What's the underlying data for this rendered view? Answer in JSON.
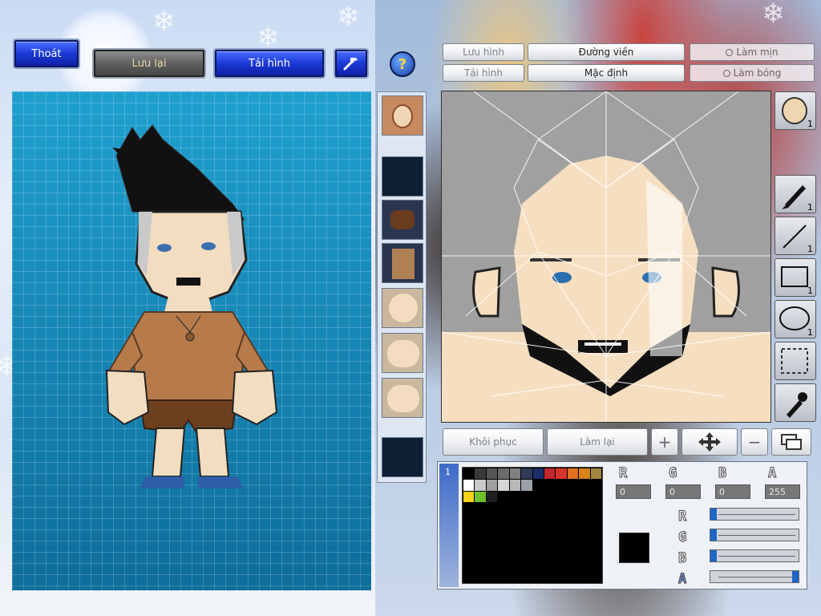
{
  "toolbar": {
    "exit_label": "Thoát",
    "save_label": "Lưu lại",
    "reload_label": "Tải hình",
    "hammer_icon": "hammer-icon",
    "help_icon": "help-icon"
  },
  "editor": {
    "save_image_label": "Lưu hình",
    "load_image_label": "Tải hình",
    "outline_label": "Đường viền",
    "default_label": "Mặc định",
    "smooth_label": "Làm mịn",
    "gloss_label": "Làm bóng",
    "restore_label": "Khôi phục",
    "redo_label": "Làm lại"
  },
  "tools": {
    "head_count": "1",
    "pen_count": "1",
    "line_count": "1",
    "rect_count": "1",
    "ellipse_count": "1"
  },
  "color": {
    "r_label": "R",
    "g_label": "G",
    "b_label": "B",
    "a_label": "A",
    "r_value": "0",
    "g_value": "0",
    "b_value": "0",
    "a_value": "255",
    "r_level": 0,
    "g_level": 0,
    "b_level": 0,
    "a_level": 1.0,
    "current": "#000000"
  },
  "palette": {
    "row1": [
      "#000000",
      "#3a3a3a",
      "#555555",
      "#6b6b6b",
      "#808080",
      "#2f3b57",
      "#1a2f6b",
      "#c0282d",
      "#d8332b",
      "#e0701e",
      "#d78418",
      "#a4873e"
    ],
    "row2": [
      "#ffffff",
      "#c9c9c9",
      "#9f9f9f",
      "#d6d6d6",
      "#b8b8b8",
      "#9aa0a8",
      "#000000",
      "#000000",
      "#000000",
      "#000000",
      "#000000",
      "#000000"
    ],
    "row3": [
      "#f2d21a",
      "#6ec12a",
      "#1f1f1f",
      "#000000",
      "#000000",
      "#000000",
      "#000000",
      "#000000",
      "#000000",
      "#000000",
      "#000000",
      "#000000"
    ]
  }
}
